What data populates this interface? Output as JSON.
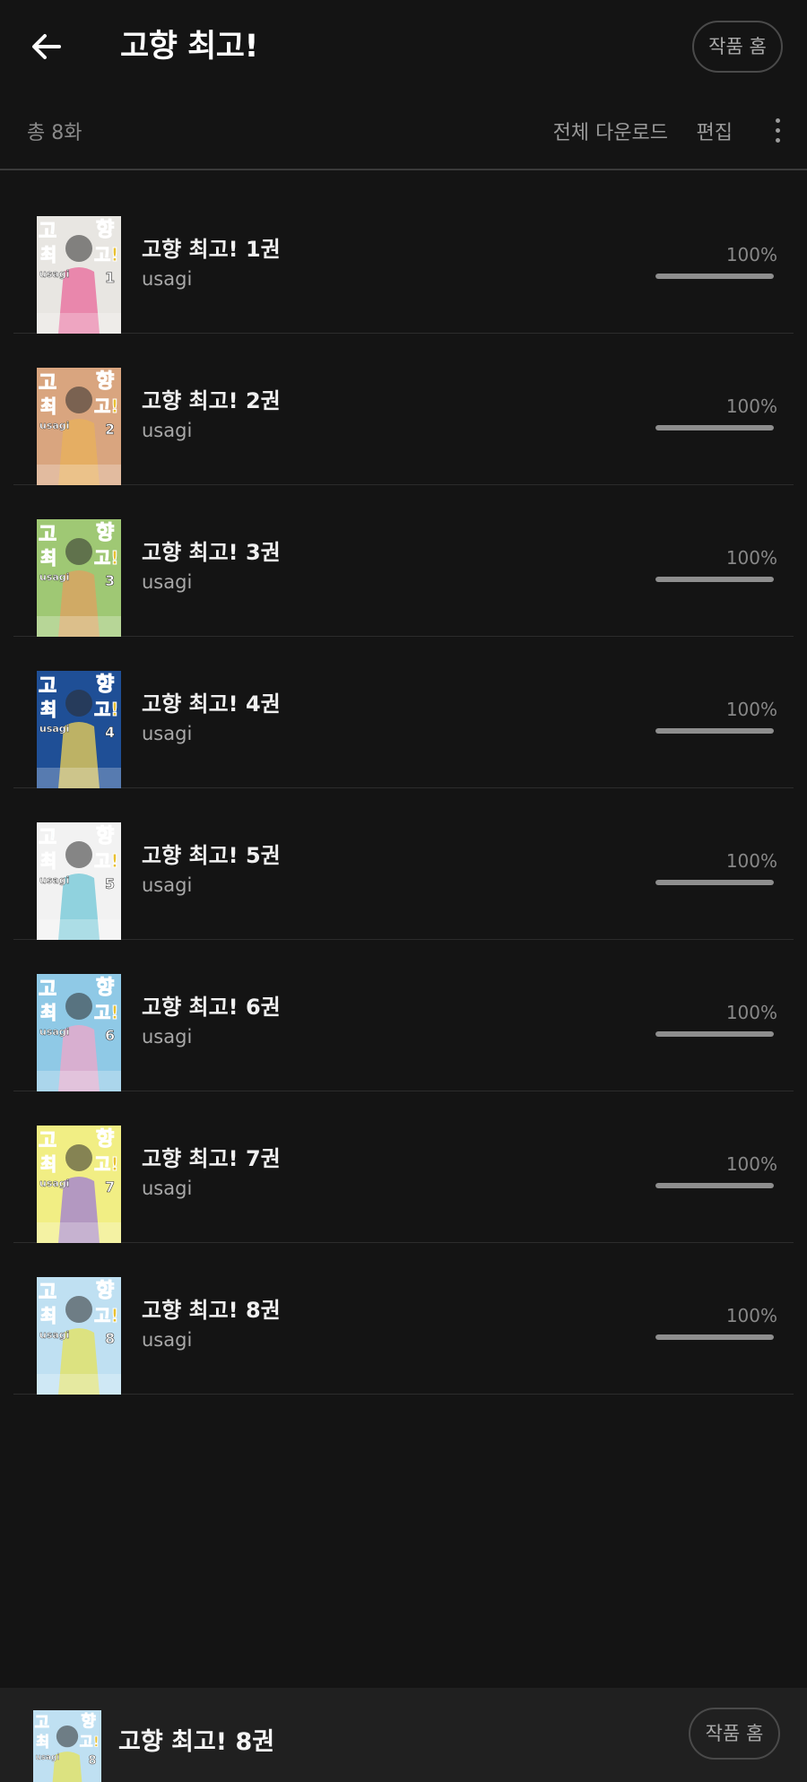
{
  "header": {
    "title": "고향 최고!",
    "back_icon": "arrow-left-icon",
    "home_button_label": "작품 홈"
  },
  "toolbar": {
    "total_count": "총 8화",
    "download_all_label": "전체 다운로드",
    "edit_label": "편집",
    "more_icon": "more-vertical-icon"
  },
  "items": [
    {
      "title": "고향 최고! 1권",
      "author": "usagi",
      "progress_label": "100%",
      "progress": 1.0,
      "volume": "1",
      "cover_bg": "#e8e6e2",
      "accent": "#e9679a"
    },
    {
      "title": "고향 최고! 2권",
      "author": "usagi",
      "progress_label": "100%",
      "progress": 1.0,
      "volume": "2",
      "cover_bg": "#d9a57f",
      "accent": "#e8b25a"
    },
    {
      "title": "고향 최고! 3권",
      "author": "usagi",
      "progress_label": "100%",
      "progress": 1.0,
      "volume": "3",
      "cover_bg": "#9fc874",
      "accent": "#e0a060"
    },
    {
      "title": "고향 최고! 4권",
      "author": "usagi",
      "progress_label": "100%",
      "progress": 1.0,
      "volume": "4",
      "cover_bg": "#1f4f96",
      "accent": "#f3d354"
    },
    {
      "title": "고향 최고! 5권",
      "author": "usagi",
      "progress_label": "100%",
      "progress": 1.0,
      "volume": "5",
      "cover_bg": "#f2f2f2",
      "accent": "#6fc7d7"
    },
    {
      "title": "고향 최고! 6권",
      "author": "usagi",
      "progress_label": "100%",
      "progress": 1.0,
      "volume": "6",
      "cover_bg": "#8fc9e6",
      "accent": "#f0a6c8"
    },
    {
      "title": "고향 최고! 7권",
      "author": "usagi",
      "progress_label": "100%",
      "progress": 1.0,
      "volume": "7",
      "cover_bg": "#f1ee84",
      "accent": "#9d7bd6"
    },
    {
      "title": "고향 최고! 8권",
      "author": "usagi",
      "progress_label": "100%",
      "progress": 1.0,
      "volume": "8",
      "cover_bg": "#bfe0f2",
      "accent": "#e6e35a"
    }
  ],
  "now_reading": {
    "title": "고향 최고! 8권",
    "home_button_label": "작품 홈",
    "volume": "8",
    "cover_bg": "#bfe0f2",
    "accent": "#e6e35a"
  },
  "colors": {
    "background": "#141414",
    "bottom_bar": "#202020",
    "progress_fill": "#8e8e8e",
    "progress_track": "#3b3b3b"
  }
}
